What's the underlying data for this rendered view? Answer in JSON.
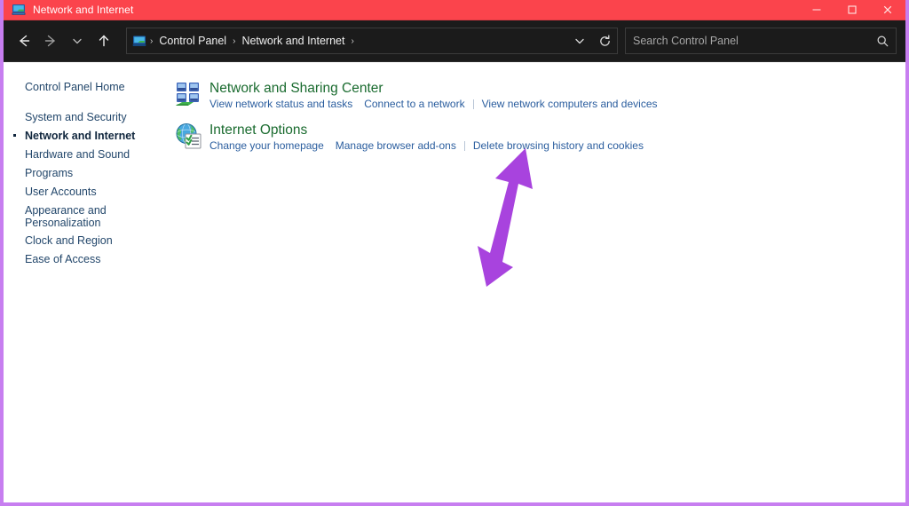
{
  "window": {
    "title": "Network and Internet",
    "icon": "network-computer-icon",
    "accent_titlebar_color": "#FB444C",
    "frame_border_color": "#C77EF0",
    "navbar_color": "#1B1B1B",
    "controls": {
      "minimize_label": "─",
      "maximize_label": "☐",
      "close_label": "✕"
    }
  },
  "navbar": {
    "back_label": "←",
    "forward_label": "→",
    "recent_label": "⌄",
    "up_label": "↑",
    "breadcrumb_icon": "computer-icon",
    "breadcrumbs": [
      {
        "label": "Control Panel"
      },
      {
        "label": "Network and Internet"
      }
    ],
    "separator": "›",
    "dropdown_label": "⌄",
    "refresh_label": "⟳"
  },
  "search": {
    "placeholder": "Search Control Panel",
    "value": "",
    "icon": "search-icon"
  },
  "sidebar": {
    "home_label": "Control Panel Home",
    "items": [
      {
        "label": "System and Security",
        "current": false
      },
      {
        "label": "Network and Internet",
        "current": true
      },
      {
        "label": "Hardware and Sound",
        "current": false
      },
      {
        "label": "Programs",
        "current": false
      },
      {
        "label": "User Accounts",
        "current": false
      },
      {
        "label": "Appearance and Personalization",
        "current": false
      },
      {
        "label": "Clock and Region",
        "current": false
      },
      {
        "label": "Ease of Access",
        "current": false
      }
    ]
  },
  "main": {
    "categories": [
      {
        "icon": "network-sharing-icon",
        "title": "Network and Sharing Center",
        "links": [
          "View network status and tasks",
          "Connect to a network",
          "View network computers and devices"
        ]
      },
      {
        "icon": "internet-options-globe-icon",
        "title": "Internet Options",
        "links": [
          "Change your homepage",
          "Manage browser add-ons",
          "Delete browsing history and cookies"
        ]
      }
    ]
  },
  "annotation": {
    "type": "arrow",
    "color": "#A843DE",
    "points_to": "Network and Sharing Center"
  }
}
